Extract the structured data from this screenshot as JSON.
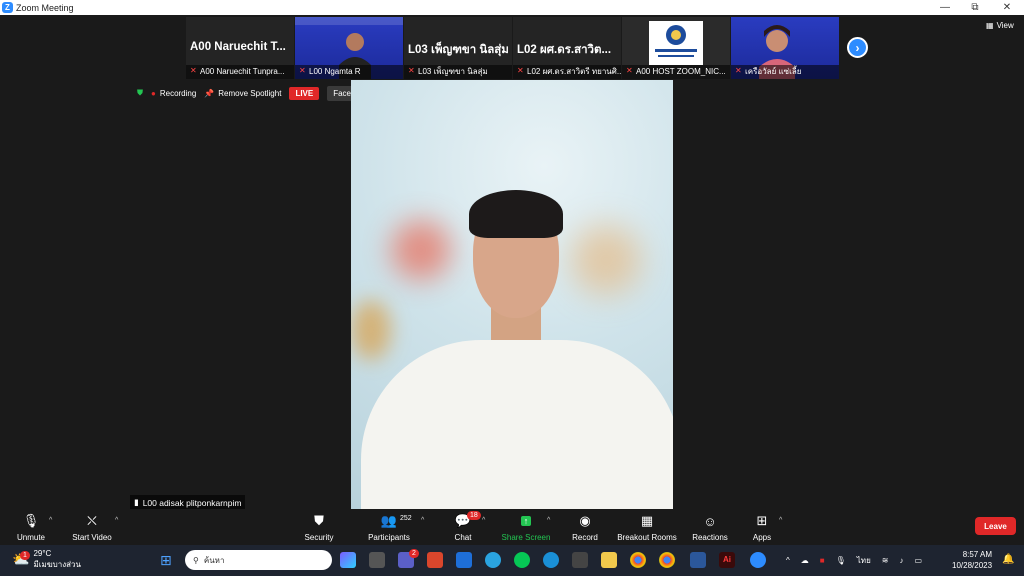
{
  "window": {
    "title": "Zoom Meeting",
    "minimize": "—",
    "restore": "⧉",
    "close": "✕"
  },
  "thumbnails": [
    {
      "big": "A00 Naruechit T...",
      "label": "A00 Naruechit Tunpra...",
      "video": false
    },
    {
      "big": "",
      "label": "L00 Ngamta R",
      "video": "presenter"
    },
    {
      "big": "L03 เพ็ญฑขา  นิลสุ่ม",
      "label": "L03 เพ็ญฑขา  นิลสุ่ม",
      "video": false
    },
    {
      "big": "L02 ผศ.ดร.สาวิต...",
      "label": "L02 ผศ.ดร.สาวิตรี ทยานศิ...",
      "video": false
    },
    {
      "big": "",
      "label": "A00 HOST ZOOM_NIC...",
      "video": "logo"
    },
    {
      "big": "",
      "label": "เครือวัลย์  แซ่เลี้ย",
      "video": "woman"
    }
  ],
  "view_label": "View",
  "status": {
    "recording": "Recording",
    "remove_spotlight": "Remove Spotlight",
    "live": "LIVE",
    "facebook": "Facebook"
  },
  "speaker_name": "L00 adisak plitponkarnpim",
  "toolbar": {
    "unmute": "Unmute",
    "start_video": "Start Video",
    "security": "Security",
    "participants": "Participants",
    "participants_count": "252",
    "chat": "Chat",
    "chat_badge": "18",
    "share": "Share Screen",
    "record": "Record",
    "breakout": "Breakout Rooms",
    "reactions": "Reactions",
    "apps": "Apps",
    "leave": "Leave"
  },
  "taskbar": {
    "temp": "29°C",
    "weather_desc": "มีเมฆบางส่วน",
    "weather_badge": "1",
    "search_placeholder": "ค้นหา",
    "lang": "ไทย",
    "time": "8:57 AM",
    "date": "10/28/2023",
    "teams_badge": "2"
  },
  "colors": {
    "accent": "#2d8cff",
    "leave": "#e02828",
    "share": "#23c552"
  }
}
